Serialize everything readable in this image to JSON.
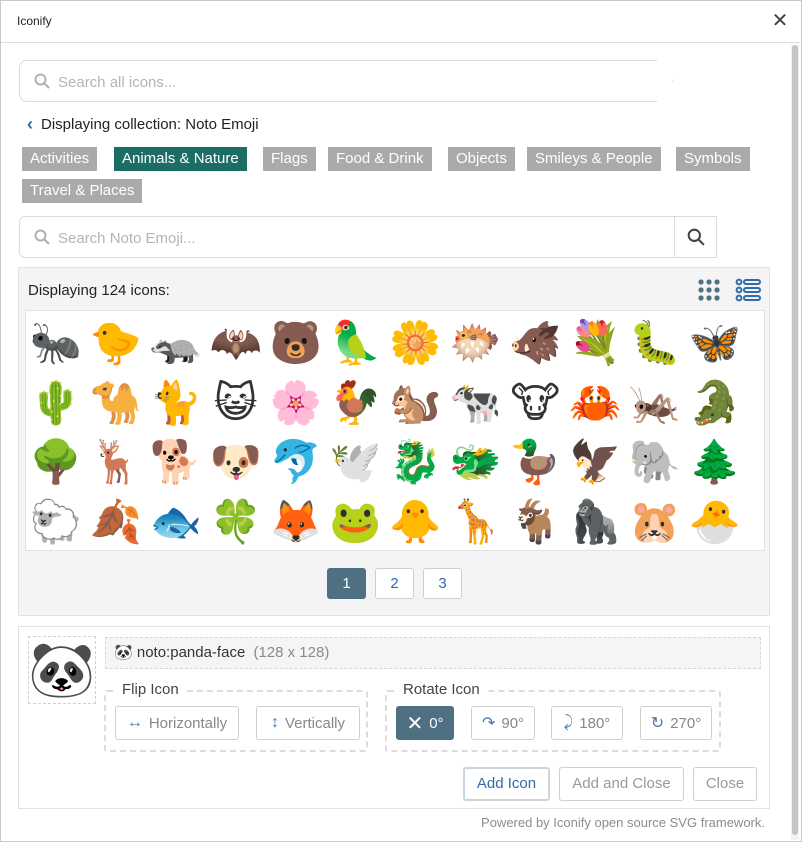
{
  "window": {
    "title": "Iconify",
    "close_label": "✕"
  },
  "search_all": {
    "placeholder": "Search all icons..."
  },
  "back": {
    "label": "Displaying collection: Noto Emoji"
  },
  "filters": [
    {
      "label": "Activities",
      "active": false
    },
    {
      "label": "Animals & Nature",
      "active": true
    },
    {
      "label": "Flags",
      "active": false
    },
    {
      "label": "Food & Drink",
      "active": false
    },
    {
      "label": "Objects",
      "active": false
    },
    {
      "label": "Smileys & People",
      "active": false
    },
    {
      "label": "Symbols",
      "active": false
    },
    {
      "label": "Travel & Places",
      "active": false
    }
  ],
  "search_collection": {
    "placeholder": "Search Noto Emoji..."
  },
  "results": {
    "count_label": "Displaying 124 icons:",
    "icons": [
      [
        "🐜",
        "🐤",
        "🦡",
        "🦇",
        "🐻",
        "🦜",
        "🌼",
        "🐡",
        "🐗",
        "💐",
        "🐛",
        "🦋"
      ],
      [
        "🌵",
        "🐪",
        "🐈",
        "😺",
        "🌸",
        "🐓",
        "🐿️",
        "🐄",
        "🐮",
        "🦀",
        "🦗",
        "🐊"
      ],
      [
        "🌳",
        "🦌",
        "🐕",
        "🐶",
        "🐬",
        "🕊️",
        "🐉",
        "🐲",
        "🦆",
        "🦅",
        "🐘",
        "🌲"
      ],
      [
        "🐑",
        "🍂",
        "🐟",
        "🍀",
        "🦊",
        "🐸",
        "🐥",
        "🦒",
        "🐐",
        "🦍",
        "🐹",
        "🐣"
      ]
    ]
  },
  "pagination": {
    "pages": [
      "1",
      "2",
      "3"
    ],
    "current": "1"
  },
  "selected": {
    "preview_icon": "🐼",
    "name_icon": "🐼",
    "name": "noto:panda-face",
    "size": "(128 x 128)"
  },
  "flip": {
    "legend": "Flip Icon",
    "horizontal_label": "Horizontally",
    "vertical_label": "Vertically"
  },
  "rotate": {
    "legend": "Rotate Icon",
    "options": [
      "0°",
      "90°",
      "180°",
      "270°"
    ],
    "current": "0°"
  },
  "actions": {
    "add": "Add Icon",
    "add_close": "Add and Close",
    "close": "Close"
  },
  "footer": {
    "powered_by": "Powered by Iconify open source SVG framework."
  },
  "colors": {
    "accent": "#1c6e64",
    "filter_gray": "#aaaaaa",
    "active_button": "#4f6f82",
    "link_blue": "#2f6ca9"
  }
}
